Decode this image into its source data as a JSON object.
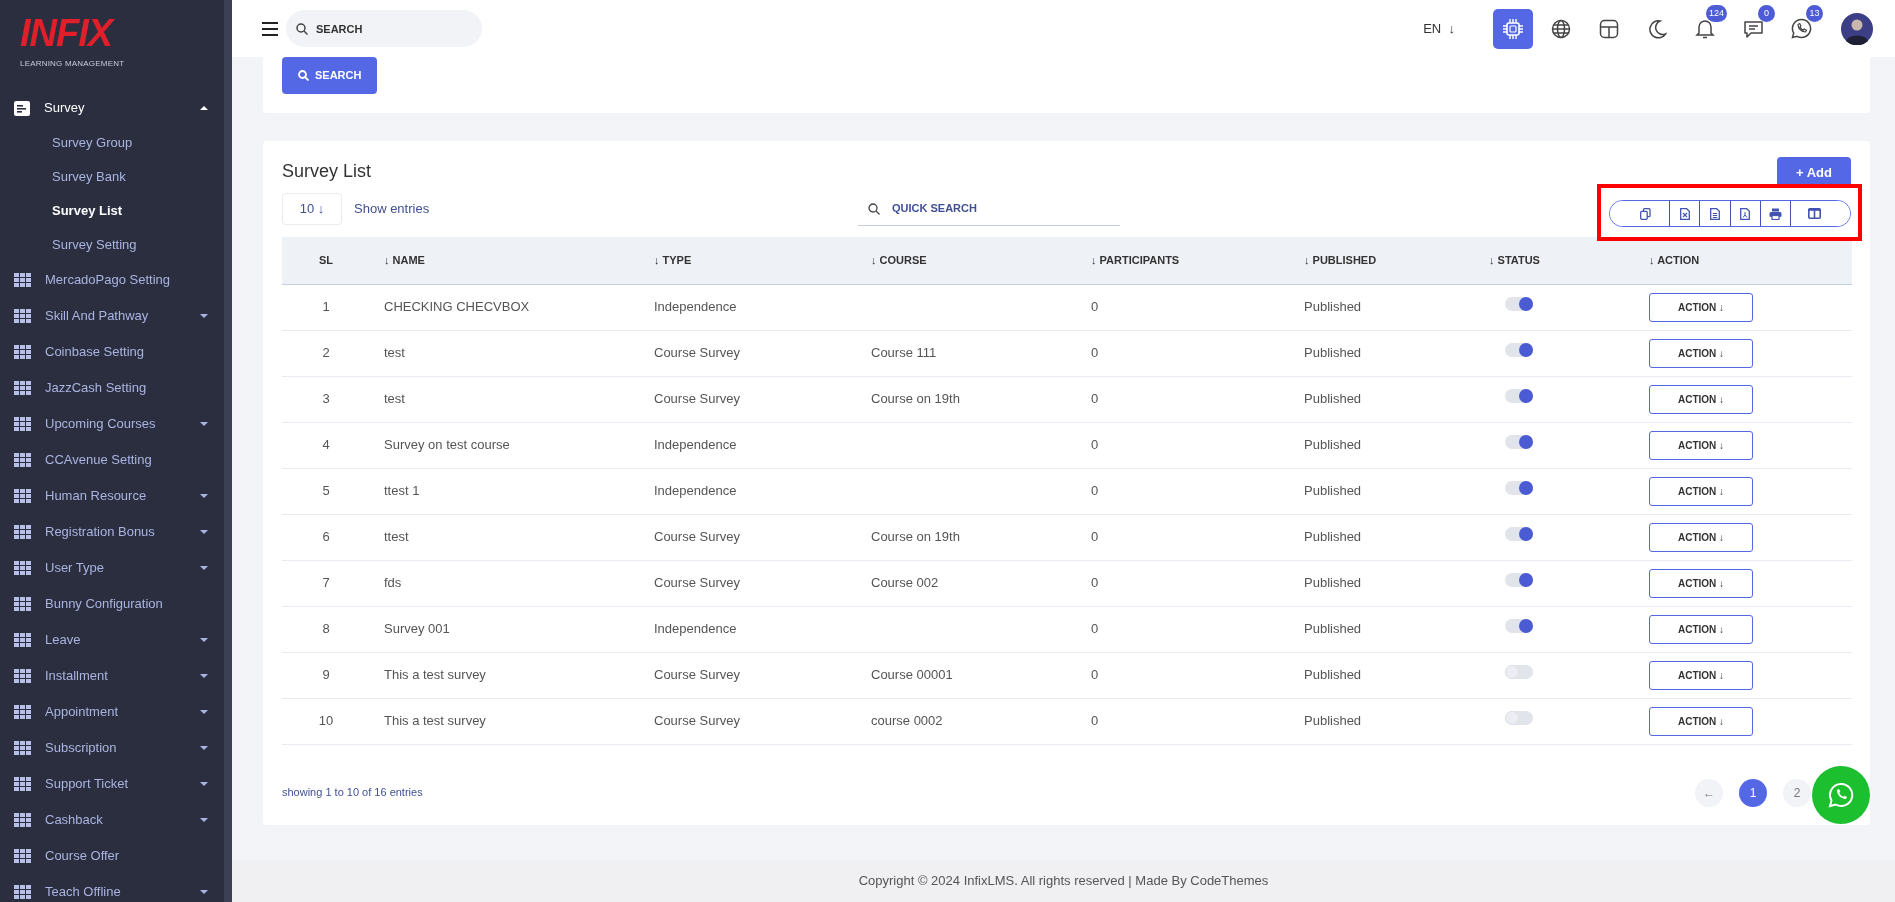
{
  "sidebar": {
    "logo": "INFIX",
    "logo_subtitle": "LEARNING MANAGEMENT",
    "items": [
      {
        "label": "Survey",
        "kind": "survey",
        "expandable": true,
        "expanded": true,
        "children": [
          {
            "label": "Survey Group",
            "selected": false
          },
          {
            "label": "Survey Bank",
            "selected": false
          },
          {
            "label": "Survey List",
            "selected": true
          },
          {
            "label": "Survey Setting",
            "selected": false
          }
        ]
      },
      {
        "label": "MercadoPago Setting",
        "kind": "grid",
        "expandable": false,
        "expanded": false
      },
      {
        "label": "Skill And Pathway",
        "kind": "grid",
        "expandable": true,
        "expanded": false
      },
      {
        "label": "Coinbase Setting",
        "kind": "grid",
        "expandable": false,
        "expanded": false
      },
      {
        "label": "JazzCash Setting",
        "kind": "grid",
        "expandable": false,
        "expanded": false
      },
      {
        "label": "Upcoming Courses",
        "kind": "grid",
        "expandable": true,
        "expanded": false
      },
      {
        "label": "CCAvenue Setting",
        "kind": "grid",
        "expandable": false,
        "expanded": false
      },
      {
        "label": "Human Resource",
        "kind": "grid",
        "expandable": true,
        "expanded": false
      },
      {
        "label": "Registration Bonus",
        "kind": "grid",
        "expandable": true,
        "expanded": false
      },
      {
        "label": "User Type",
        "kind": "grid",
        "expandable": true,
        "expanded": false
      },
      {
        "label": "Bunny Configuration",
        "kind": "grid",
        "expandable": false,
        "expanded": false
      },
      {
        "label": "Leave",
        "kind": "grid",
        "expandable": true,
        "expanded": false
      },
      {
        "label": "Installment",
        "kind": "grid",
        "expandable": true,
        "expanded": false
      },
      {
        "label": "Appointment",
        "kind": "grid",
        "expandable": true,
        "expanded": false
      },
      {
        "label": "Subscription",
        "kind": "grid",
        "expandable": true,
        "expanded": false
      },
      {
        "label": "Support Ticket",
        "kind": "grid",
        "expandable": true,
        "expanded": false
      },
      {
        "label": "Cashback",
        "kind": "grid",
        "expandable": true,
        "expanded": false
      },
      {
        "label": "Course Offer",
        "kind": "grid",
        "expandable": false,
        "expanded": false
      },
      {
        "label": "Teach Offline",
        "kind": "grid",
        "expandable": true,
        "expanded": false
      }
    ]
  },
  "header": {
    "search": {
      "placeholder": "SEARCH"
    },
    "language": "EN",
    "language_caret": "↓",
    "icons": [
      {
        "kind": "ai",
        "selected": true
      },
      {
        "kind": "globe",
        "selected": false
      },
      {
        "kind": "layout",
        "selected": false
      },
      {
        "kind": "moon",
        "selected": false
      },
      {
        "kind": "bell",
        "selected": false,
        "badge": "124"
      },
      {
        "kind": "chat",
        "selected": false,
        "badge": "0"
      },
      {
        "kind": "whatsapp",
        "selected": false,
        "badge": "13"
      }
    ]
  },
  "search_panel": {
    "button": "SEARCH"
  },
  "survey_list": {
    "title": "Survey List",
    "add_button": "+ Add",
    "entries": {
      "value": "10",
      "caret": "↓",
      "label": "Show entries"
    },
    "quick_search": {
      "placeholder": "QUICK SEARCH"
    },
    "export_toolbar": {
      "highlighted": true,
      "buttons": [
        {
          "kind": "copy"
        },
        {
          "kind": "excel"
        },
        {
          "kind": "csv"
        },
        {
          "kind": "pdf"
        },
        {
          "kind": "print"
        },
        {
          "kind": "columns"
        }
      ]
    },
    "table": {
      "columns": [
        "SL",
        "↓ NAME",
        "↓ TYPE",
        "↓ COURSE",
        "↓ PARTICIPANTS",
        "↓ PUBLISHED",
        "↓ STATUS",
        "↓ ACTION"
      ],
      "rows": [
        {
          "sl": "1",
          "name": "CHECKING CHECVBOX",
          "type": "Independence",
          "course": "",
          "participants": "0",
          "published": "Published",
          "status": true,
          "action": "ACTION ↓"
        },
        {
          "sl": "2",
          "name": "test",
          "type": "Course Survey",
          "course": "Course 111",
          "participants": "0",
          "published": "Published",
          "status": true,
          "action": "ACTION ↓"
        },
        {
          "sl": "3",
          "name": "test",
          "type": "Course Survey",
          "course": "Course on 19th",
          "participants": "0",
          "published": "Published",
          "status": true,
          "action": "ACTION ↓"
        },
        {
          "sl": "4",
          "name": "Survey on test course",
          "type": "Independence",
          "course": "",
          "participants": "0",
          "published": "Published",
          "status": true,
          "action": "ACTION ↓"
        },
        {
          "sl": "5",
          "name": "ttest 1",
          "type": "Independence",
          "course": "",
          "participants": "0",
          "published": "Published",
          "status": true,
          "action": "ACTION ↓"
        },
        {
          "sl": "6",
          "name": "ttest",
          "type": "Course Survey",
          "course": "Course on 19th",
          "participants": "0",
          "published": "Published",
          "status": true,
          "action": "ACTION ↓"
        },
        {
          "sl": "7",
          "name": "fds",
          "type": "Course Survey",
          "course": "Course 002",
          "participants": "0",
          "published": "Published",
          "status": true,
          "action": "ACTION ↓"
        },
        {
          "sl": "8",
          "name": "Survey 001",
          "type": "Independence",
          "course": "",
          "participants": "0",
          "published": "Published",
          "status": true,
          "action": "ACTION ↓"
        },
        {
          "sl": "9",
          "name": "This a test survey",
          "type": "Course Survey",
          "course": "Course 00001",
          "participants": "0",
          "published": "Published",
          "status": false,
          "action": "ACTION ↓"
        },
        {
          "sl": "10",
          "name": "This a test survey",
          "type": "Course Survey",
          "course": "course 0002",
          "participants": "0",
          "published": "Published",
          "status": false,
          "action": "ACTION ↓"
        }
      ]
    },
    "summary": "showing 1 to 10 of 16 entries",
    "pagination": {
      "previous": "←",
      "pages": [
        {
          "label": "1",
          "selected": true
        },
        {
          "label": "2",
          "selected": false
        }
      ]
    }
  },
  "footer": "Copyright © 2024 InfixLMS. All rights reserved | Made By CodeThemes"
}
